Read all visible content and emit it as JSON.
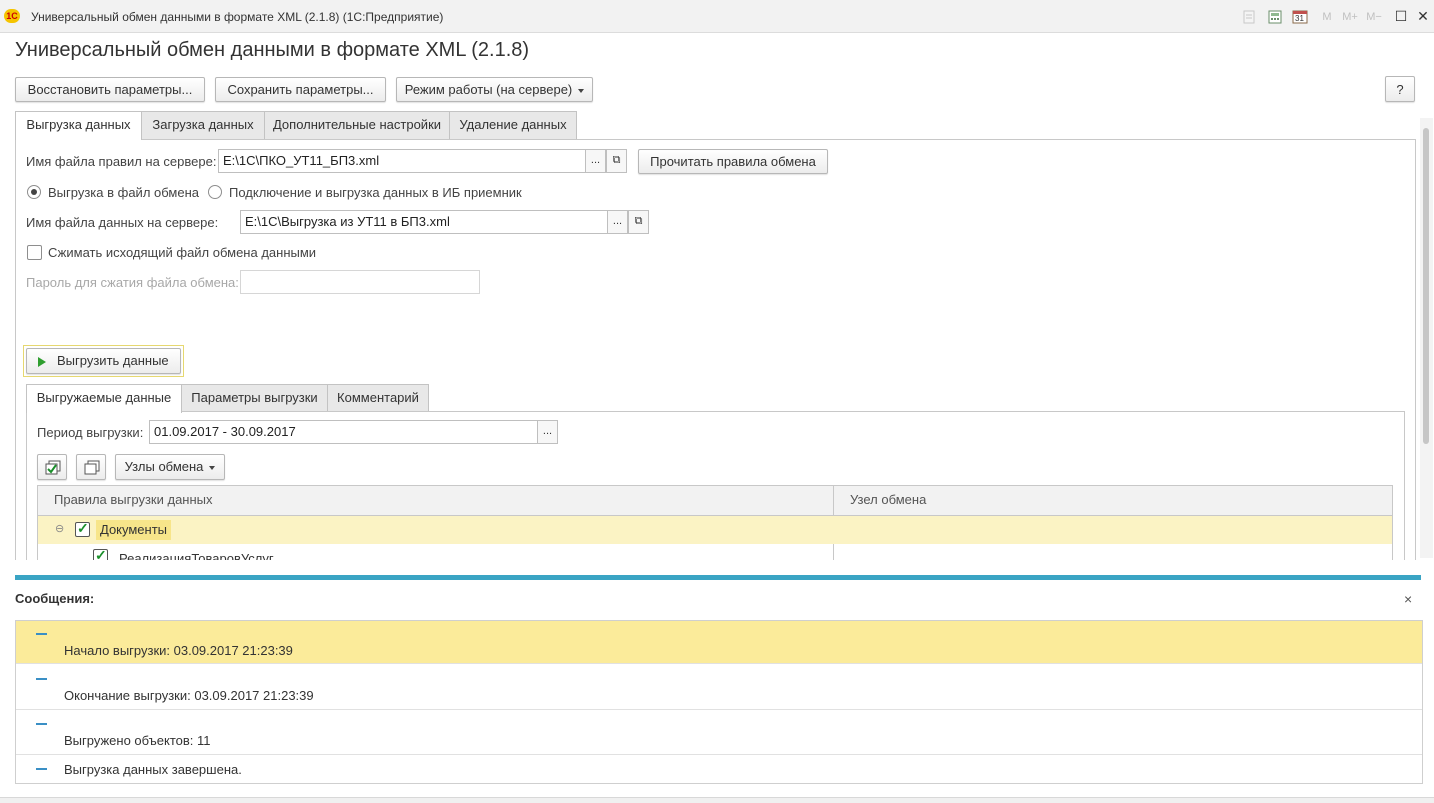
{
  "window": {
    "app_logo": "1С",
    "title": "Универсальный обмен данными в формате XML (2.1.8)  (1С:Предприятие)",
    "toolbar_icons": [
      "print-icon",
      "calculator-icon",
      "calendar-icon"
    ],
    "calendar_day": "31",
    "memory_buttons": [
      "M",
      "M+",
      "M−"
    ],
    "maximize": "☐",
    "close": "✕"
  },
  "page_title": "Универсальный обмен данными в формате XML (2.1.8)",
  "commands": {
    "restore_params": "Восстановить параметры...",
    "save_params": "Сохранить параметры...",
    "mode": "Режим работы (на сервере)",
    "help": "?"
  },
  "tabs": [
    "Выгрузка данных",
    "Загрузка данных",
    "Дополнительные настройки",
    "Удаление данных"
  ],
  "export": {
    "rules_file_label": "Имя файла правил на сервере:",
    "rules_file_value": "E:\\1C\\ПКО_УТ11_БП3.xml",
    "read_rules_button": "Прочитать правила обмена",
    "radio_export_to_file": "Выгрузка в файл обмена",
    "radio_connect_export": "Подключение и выгрузка данных в ИБ приемник",
    "data_file_label": "Имя файла данных на сервере:",
    "data_file_value": "E:\\1C\\Выгрузка из УТ11 в БП3.xml",
    "compress_label": "Сжимать исходящий файл обмена данными",
    "password_label": "Пароль для сжатия файла обмена:",
    "password_value": "",
    "export_button": "Выгрузить данные",
    "inner_tabs": [
      "Выгружаемые данные",
      "Параметры выгрузки",
      "Комментарий"
    ],
    "period_label": "Период выгрузки:",
    "period_value": "01.09.2017 - 30.09.2017",
    "nodes_button": "Узлы обмена",
    "table": {
      "columns": [
        "Правила выгрузки данных",
        "Узел обмена"
      ],
      "rows": [
        {
          "label": "Документы",
          "checked": true,
          "expanded": true,
          "node": ""
        },
        {
          "label": "РеализацияТоваровУслуг",
          "checked": true,
          "node": ""
        }
      ]
    }
  },
  "messages": {
    "title": "Сообщения:",
    "close": "×",
    "items": [
      "Начало выгрузки: 03.09.2017 21:23:39",
      "Окончание выгрузки: 03.09.2017 21:23:39",
      "Выгружено объектов: 11",
      "Выгрузка данных завершена."
    ]
  },
  "colors": {
    "selected_row": "#fbeb9a",
    "messages_accent": "#3aa4c4",
    "check_green": "#1a8f2a",
    "focus_outline": "#e6d870"
  },
  "ellipsis": "...",
  "open_icon": "⧉",
  "collapse_icon": "⊖"
}
